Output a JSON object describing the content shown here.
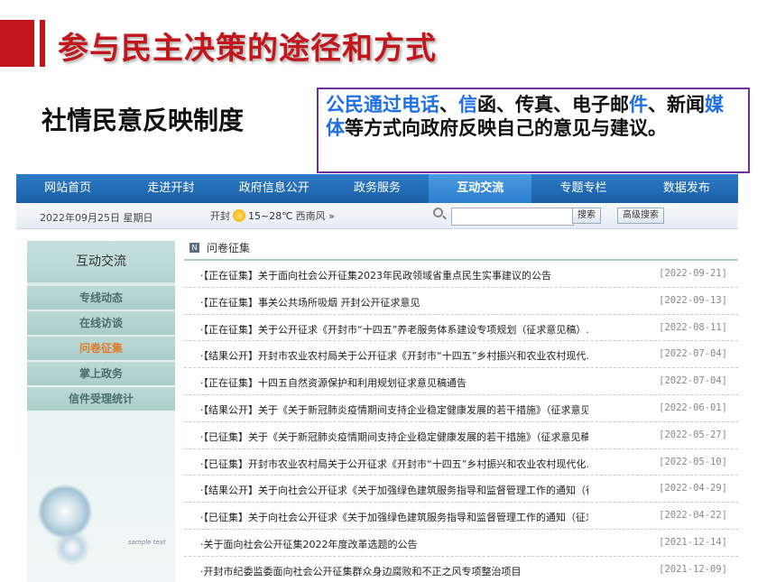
{
  "slide": {
    "title": "参与民主决策的途径和方式",
    "heading": "社情民意反映制度",
    "callout_parts": [
      {
        "text": "公民通过电话",
        "hl": true
      },
      {
        "text": "、",
        "hl": false
      },
      {
        "text": "信",
        "hl": true
      },
      {
        "text": "函、传真、电子邮",
        "hl": false
      },
      {
        "text": "件",
        "hl": true
      },
      {
        "text": "、",
        "hl": false
      },
      {
        "text": "新闻",
        "hl": false
      },
      {
        "text": "媒体",
        "hl": true
      },
      {
        "text": "等方式向政府反映自己的意见与建议。",
        "hl": false
      }
    ],
    "colors": {
      "accent_red": "#c0161c",
      "highlight_blue": "#1f6fe5",
      "callout_border": "#7030a0"
    }
  },
  "site": {
    "nav": [
      {
        "label": "网站首页",
        "active": false
      },
      {
        "label": "走进开封",
        "active": false
      },
      {
        "label": "政府信息公开",
        "active": false
      },
      {
        "label": "政务服务",
        "active": false
      },
      {
        "label": "互动交流",
        "active": true
      },
      {
        "label": "专题专栏",
        "active": false
      },
      {
        "label": "数据发布",
        "active": false
      }
    ],
    "date": "2022年09月25日 星期日",
    "weather": {
      "city": "开封",
      "temp": "15~28℃",
      "wind": "西南风 »"
    },
    "search_button": "搜索",
    "advanced_search_button": "高级搜索",
    "sidebar": {
      "title": "互动交流",
      "items": [
        {
          "label": "专线动态",
          "active": false
        },
        {
          "label": "在线访谈",
          "active": false
        },
        {
          "label": "问卷征集",
          "active": true
        },
        {
          "label": "掌上政务",
          "active": false
        },
        {
          "label": "信件受理统计",
          "active": false
        }
      ],
      "watermark": "sample text"
    },
    "section_title": "问卷征集",
    "list": [
      {
        "text": "·【正在征集】关于面向社会公开征集2023年民政领域省重点民生实事建议的公告",
        "date": "[2022-09-21]"
      },
      {
        "text": "·【正在征集】事关公共场所吸烟 开封公开征求意见",
        "date": "[2022-09-13]"
      },
      {
        "text": "·【正在征集】关于公开征求《开封市“十四五”养老服务体系建设专项规划（征求意见稿）...",
        "date": "[2022-08-11]"
      },
      {
        "text": "·【结果公开】开封市农业农村局关于公开征求《开封市“十四五”乡村振兴和农业农村现代...",
        "date": "[2022-07-04]"
      },
      {
        "text": "·【正在征集】十四五自然资源保护和利用规划征求意见稿通告",
        "date": "[2022-07-04]"
      },
      {
        "text": "·【结果公开】关于《关于新冠肺炎疫情期间支持企业稳定健康发展的若干措施》（征求意见...",
        "date": "[2022-06-01]"
      },
      {
        "text": "·【已征集】关于《关于新冠肺炎疫情期间支持企业稳定健康发展的若干措施》（征求意见稿...",
        "date": "[2022-05-27]"
      },
      {
        "text": "·【已征集】开封市农业农村局关于公开征求《开封市“十四五”乡村振兴和农业农村现代化...",
        "date": "[2022-05-10]"
      },
      {
        "text": "·【结果公开】关于向社会公开征求《关于加强绿色建筑服务指导和监督管理工作的通知（征...",
        "date": "[2022-04-29]"
      },
      {
        "text": "·【已征集】关于向社会公开征求《关于加强绿色建筑服务指导和监督管理工作的通知（征求...",
        "date": "[2022-04-22]"
      },
      {
        "text": "·关于面向社会公开征集2022年度改革选题的公告",
        "date": "[2021-12-14]"
      },
      {
        "text": "·开封市纪委监委面向社会公开征集群众身边腐败和不正之风专项整治项目",
        "date": "[2021-12-09]"
      }
    ]
  }
}
